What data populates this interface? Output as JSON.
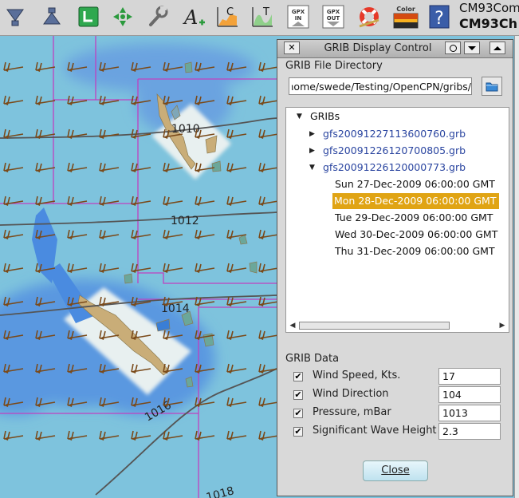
{
  "toolbar": {
    "tools": [
      {
        "name": "zoom-in-icon"
      },
      {
        "name": "zoom-out-icon"
      },
      {
        "name": "route-icon"
      },
      {
        "name": "track-icon"
      },
      {
        "name": "settings-icon"
      },
      {
        "name": "text-icon"
      },
      {
        "name": "current-icon",
        "label": "C"
      },
      {
        "name": "tide-icon",
        "label": "T"
      },
      {
        "name": "gpx-import-icon",
        "label": "GPX IN"
      },
      {
        "name": "gpx-export-icon",
        "label": "GPX OUT"
      },
      {
        "name": "man-overboard-icon"
      },
      {
        "name": "color-scheme-icon",
        "label": "Color"
      },
      {
        "name": "help-icon",
        "label": "?"
      }
    ],
    "chart_title_line1": "CM93Com",
    "chart_title_line2": "CM93Ch"
  },
  "chart": {
    "isobars": [
      "1010",
      "1012",
      "1014",
      "1016",
      "1018"
    ]
  },
  "dialog": {
    "title": "GRIB Display Control",
    "close_glyph": "✕",
    "file_dir_label": "GRIB File Directory",
    "directory_value": "/home/swede/Testing/OpenCPN/gribs",
    "tree": {
      "root": "GRIBs",
      "files": [
        "gfs20091227113600760.grb",
        "gfs20091226120700805.grb",
        "gfs20091226120000773.grb"
      ],
      "times": [
        "Sun 27-Dec-2009 06:00:00 GMT",
        "Mon 28-Dec-2009 06:00:00 GMT",
        "Tue 29-Dec-2009 06:00:00 GMT",
        "Wed 30-Dec-2009 06:00:00 GMT",
        "Thu 31-Dec-2009 06:00:00 GMT"
      ],
      "selected_time": "Mon 28-Dec-2009 06:00:00 GMT"
    },
    "data_label": "GRIB Data",
    "fields": [
      {
        "label": "Wind Speed, Kts.",
        "value": "17",
        "checked": true
      },
      {
        "label": "Wind Direction",
        "value": "104",
        "checked": true
      },
      {
        "label": "Pressure, mBar",
        "value": "1013",
        "checked": true
      },
      {
        "label": "Significant Wave Height",
        "value": "2.3",
        "checked": true
      }
    ],
    "close_label": "Close"
  },
  "colors": {
    "sea": "#7ec3dd",
    "deep": "#4b8fd6",
    "land": "#c9ad78",
    "boundary": "#c040c0",
    "wind_barb": "#7a4a1a",
    "selection": "#e0a414"
  }
}
